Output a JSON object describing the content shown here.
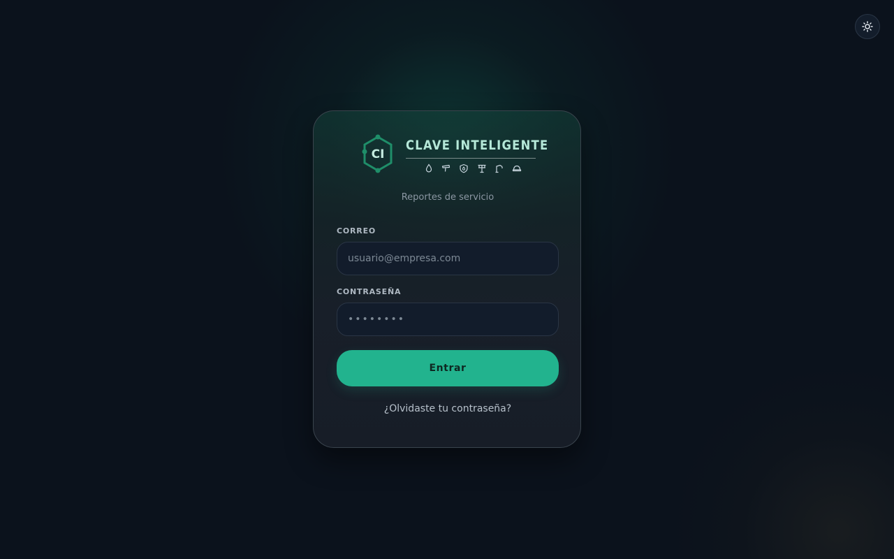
{
  "theme_toggle": {
    "icon": "sun-icon"
  },
  "brand": {
    "initials": "CI",
    "name": "CLAVE INTELIGENTE",
    "accent": "#22b38e",
    "icons": [
      "flame-icon",
      "shower-icon",
      "shield-icon",
      "faucet-icon",
      "pipe-icon",
      "helmet-icon"
    ]
  },
  "subtitle": "Reportes de servicio",
  "form": {
    "email_label": "CORREO",
    "email_placeholder": "usuario@empresa.com",
    "email_value": "",
    "password_label": "CONTRASEÑA",
    "password_placeholder": "••••••••",
    "password_value": "",
    "submit_label": "Entrar"
  },
  "forgot_link": "¿Olvidaste tu contraseña?"
}
